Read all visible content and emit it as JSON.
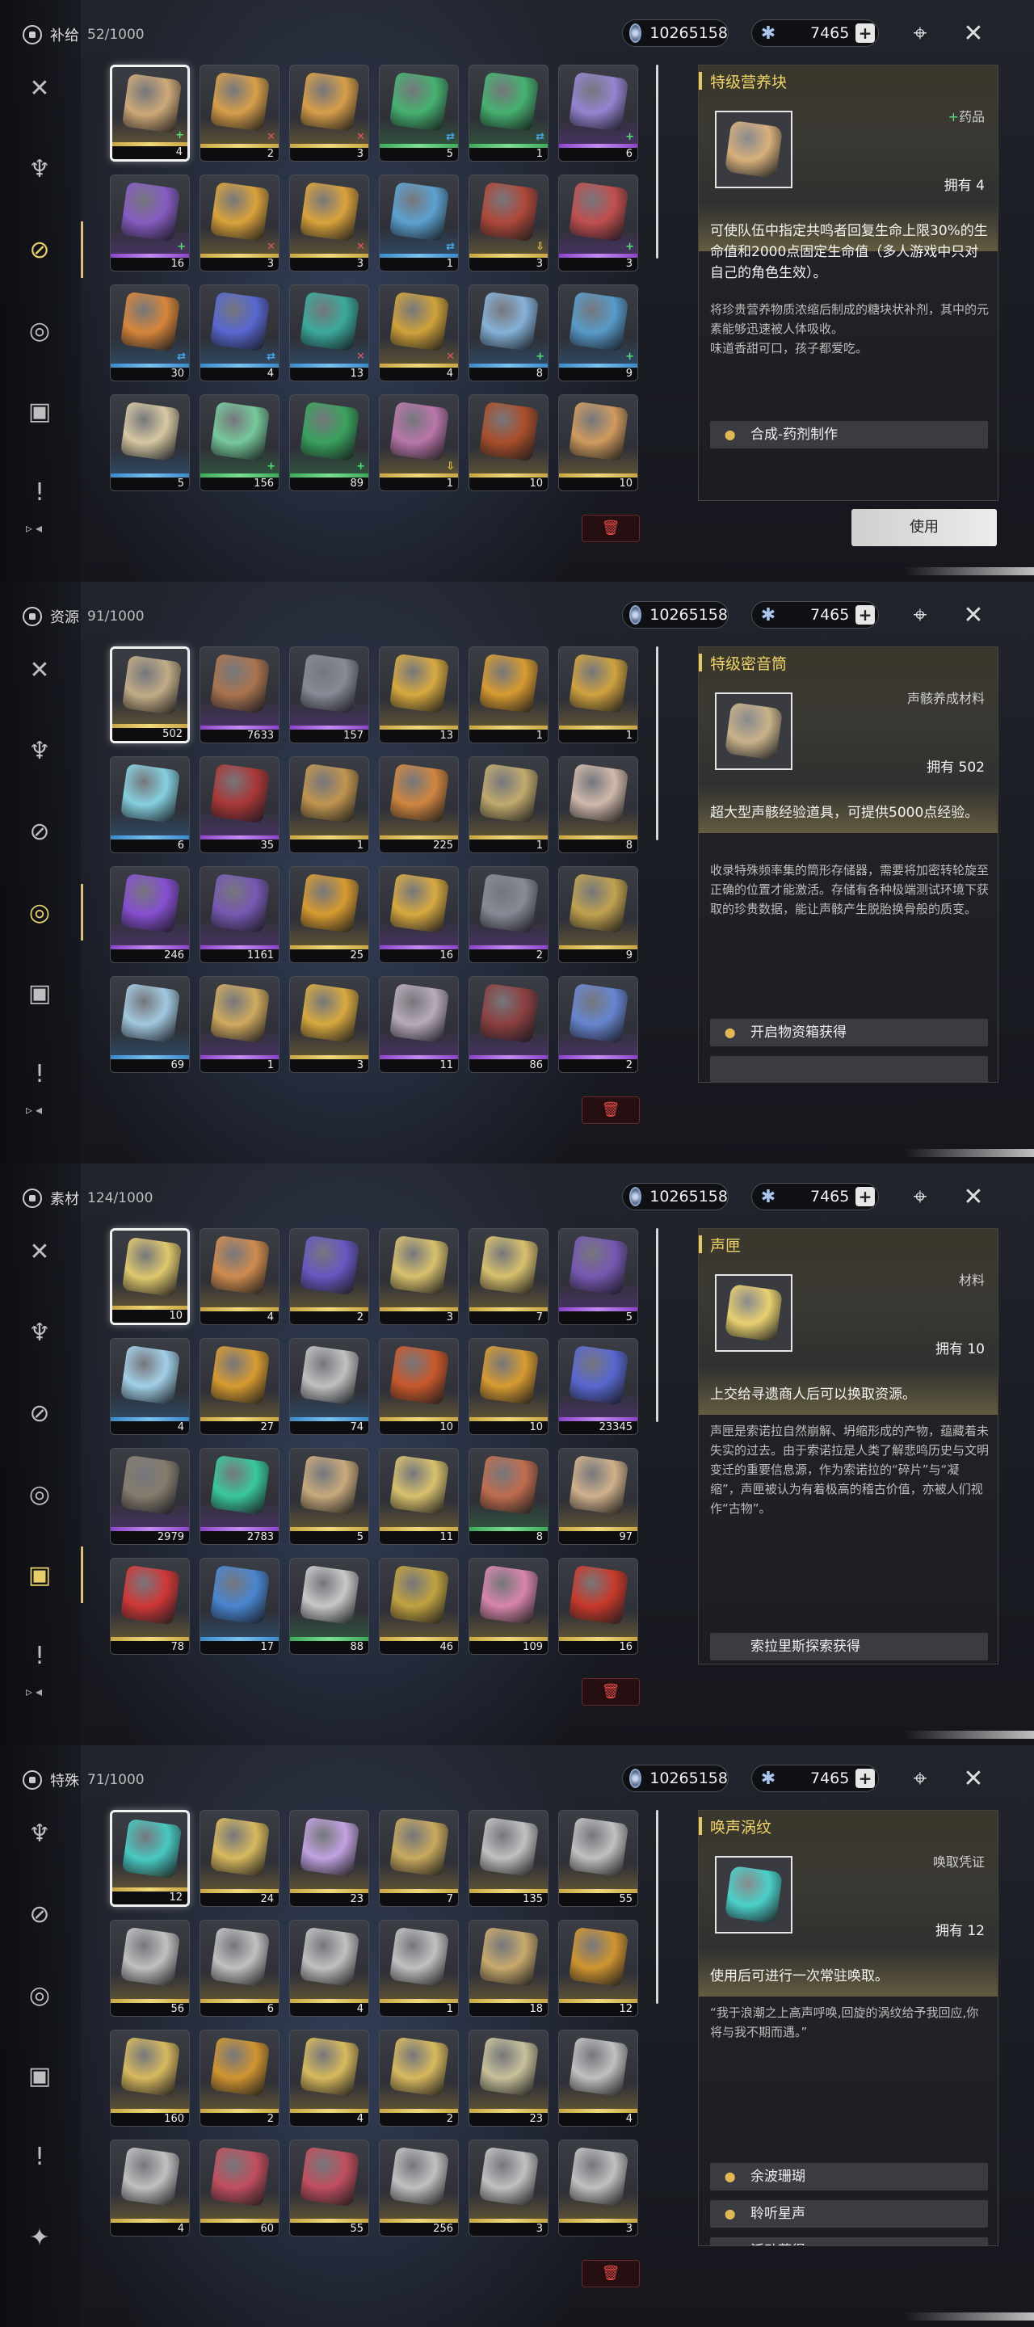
{
  "currency": {
    "primary": "10265158",
    "secondary": "7465",
    "plus": "+"
  },
  "panels": [
    {
      "title": "补给",
      "count": "52/1000",
      "active_index": 2,
      "items": [
        {
          "count": "4",
          "rarity": "g",
          "badge": "plus",
          "art": "#d7b07c"
        },
        {
          "count": "2",
          "rarity": "g",
          "badge": "x",
          "art": "#e0a44a"
        },
        {
          "count": "3",
          "rarity": "g",
          "badge": "x",
          "art": "#e0a44a"
        },
        {
          "count": "5",
          "rarity": "n",
          "badge": "swap",
          "art": "#47b873"
        },
        {
          "count": "1",
          "rarity": "n",
          "badge": "swap",
          "art": "#47b873"
        },
        {
          "count": "6",
          "rarity": "p",
          "badge": "plus",
          "art": "#9a88d8"
        },
        {
          "count": "16",
          "rarity": "p",
          "badge": "plus",
          "art": "#8a5ec8"
        },
        {
          "count": "3",
          "rarity": "g",
          "badge": "x",
          "art": "#e3a83c"
        },
        {
          "count": "3",
          "rarity": "g",
          "badge": "x",
          "art": "#e3a83c"
        },
        {
          "count": "1",
          "rarity": "b",
          "badge": "swap",
          "art": "#5fa7d8"
        },
        {
          "count": "3",
          "rarity": "g",
          "badge": "down",
          "art": "#b5493a"
        },
        {
          "count": "3",
          "rarity": "p",
          "badge": "plus",
          "art": "#c85050"
        },
        {
          "count": "30",
          "rarity": "b",
          "badge": "swap",
          "art": "#e08a3a"
        },
        {
          "count": "4",
          "rarity": "b",
          "badge": "swap",
          "art": "#5a6ad8"
        },
        {
          "count": "13",
          "rarity": "b",
          "badge": "x",
          "art": "#3ab0a0"
        },
        {
          "count": "4",
          "rarity": "g",
          "badge": "x",
          "art": "#d8a83a"
        },
        {
          "count": "8",
          "rarity": "b",
          "badge": "plus",
          "art": "#8ab8e0"
        },
        {
          "count": "9",
          "rarity": "b",
          "badge": "plus",
          "art": "#5aa0d0"
        },
        {
          "count": "5",
          "rarity": "b",
          "badge": "",
          "art": "#e0d0a8"
        },
        {
          "count": "156",
          "rarity": "n",
          "badge": "plus",
          "art": "#7ad0a0"
        },
        {
          "count": "89",
          "rarity": "n",
          "badge": "plus",
          "art": "#3aa860"
        },
        {
          "count": "1",
          "rarity": "g",
          "badge": "down",
          "art": "#c07ab0"
        },
        {
          "count": "10",
          "rarity": "g",
          "badge": "",
          "art": "#b0502a"
        },
        {
          "count": "10",
          "rarity": "g",
          "badge": "",
          "art": "#d8a060"
        }
      ],
      "detail": {
        "name": "特级营养块",
        "type": "药品",
        "type_prefix": "+",
        "owned": "拥有 4",
        "art": "#d7b07c",
        "main": "可使队伍中指定共鸣者回复生命上限30%的生命值和2000点固定生命值（多人游戏中只对自己的角色生效）。",
        "desc": "将珍贵营养物质浓缩后制成的糖块状补剂，其中的元素能够迅速被人体吸收。\n味道香甜可口，孩子都爱吃。",
        "sources": [
          "合成-药剂制作"
        ],
        "use_button": "使用"
      }
    },
    {
      "title": "资源",
      "count": "91/1000",
      "active_index": 3,
      "items": [
        {
          "count": "502",
          "rarity": "g",
          "badge": "",
          "art": "#c9b28a"
        },
        {
          "count": "7633",
          "rarity": "p",
          "badge": "",
          "art": "#b07850"
        },
        {
          "count": "157",
          "rarity": "p",
          "badge": "",
          "art": "#8a8f9a"
        },
        {
          "count": "13",
          "rarity": "g",
          "badge": "",
          "art": "#e0b040"
        },
        {
          "count": "1",
          "rarity": "g",
          "badge": "",
          "art": "#e0a030"
        },
        {
          "count": "1",
          "rarity": "g",
          "badge": "",
          "art": "#d8a840"
        },
        {
          "count": "6",
          "rarity": "b",
          "badge": "",
          "art": "#8ad8e8"
        },
        {
          "count": "35",
          "rarity": "p",
          "badge": "",
          "art": "#b03838"
        },
        {
          "count": "1",
          "rarity": "g",
          "badge": "",
          "art": "#c89a50"
        },
        {
          "count": "225",
          "rarity": "g",
          "badge": "",
          "art": "#d88a40"
        },
        {
          "count": "1",
          "rarity": "g",
          "badge": "",
          "art": "#c8b070"
        },
        {
          "count": "8",
          "rarity": "g",
          "badge": "",
          "art": "#d8c0b0"
        },
        {
          "count": "246",
          "rarity": "p",
          "badge": "",
          "art": "#8a50d8"
        },
        {
          "count": "1161",
          "rarity": "p",
          "badge": "",
          "art": "#7a5ab8"
        },
        {
          "count": "25",
          "rarity": "g",
          "badge": "",
          "art": "#e0a030"
        },
        {
          "count": "16",
          "rarity": "p",
          "badge": "",
          "art": "#e0b040"
        },
        {
          "count": "2",
          "rarity": "p",
          "badge": "",
          "art": "#8a8f9a"
        },
        {
          "count": "9",
          "rarity": "g",
          "badge": "",
          "art": "#c8a850"
        },
        {
          "count": "69",
          "rarity": "b",
          "badge": "",
          "art": "#a8d0e8"
        },
        {
          "count": "1",
          "rarity": "p",
          "badge": "",
          "art": "#d8b060"
        },
        {
          "count": "3",
          "rarity": "g",
          "badge": "",
          "art": "#e0b040"
        },
        {
          "count": "11",
          "rarity": "p",
          "badge": "",
          "art": "#c0b0c0"
        },
        {
          "count": "86",
          "rarity": "p",
          "badge": "",
          "art": "#904040"
        },
        {
          "count": "2",
          "rarity": "p",
          "badge": "",
          "art": "#6a8ad8"
        }
      ],
      "detail": {
        "name": "特级密音筒",
        "type": "声骸养成材料",
        "type_prefix": "",
        "owned": "拥有 502",
        "art": "#c9b28a",
        "main": "超大型声骸经验道具，可提供5000点经验。",
        "desc": "收录特殊频率集的筒形存储器，需要将加密转轮旋至正确的位置才能激活。存储有各种极端测试环境下获取的珍贵数据，能让声骸产生脱胎换骨般的质变。",
        "sources": [
          "开启物资箱获得",
          ""
        ],
        "use_button": ""
      }
    },
    {
      "title": "素材",
      "count": "124/1000",
      "active_index": 4,
      "items": [
        {
          "count": "10",
          "rarity": "g",
          "badge": "",
          "art": "#e8d070"
        },
        {
          "count": "4",
          "rarity": "g",
          "badge": "",
          "art": "#d89050"
        },
        {
          "count": "2",
          "rarity": "g",
          "badge": "",
          "art": "#6a5ac8"
        },
        {
          "count": "3",
          "rarity": "g",
          "badge": "",
          "art": "#e0c870"
        },
        {
          "count": "7",
          "rarity": "g",
          "badge": "",
          "art": "#e0c870"
        },
        {
          "count": "5",
          "rarity": "p",
          "badge": "",
          "art": "#7a5ab8"
        },
        {
          "count": "4",
          "rarity": "b",
          "badge": "",
          "art": "#a8d8f0"
        },
        {
          "count": "27",
          "rarity": "g",
          "badge": "",
          "art": "#e0a030"
        },
        {
          "count": "74",
          "rarity": "b",
          "badge": "",
          "art": "#c8c8c8"
        },
        {
          "count": "10",
          "rarity": "g",
          "badge": "",
          "art": "#d05a2a"
        },
        {
          "count": "10",
          "rarity": "g",
          "badge": "",
          "art": "#e0a030"
        },
        {
          "count": "23345",
          "rarity": "p",
          "badge": "",
          "art": "#5a6ad8"
        },
        {
          "count": "2979",
          "rarity": "p",
          "badge": "",
          "art": "#8a8070"
        },
        {
          "count": "2783",
          "rarity": "p",
          "badge": "",
          "art": "#3ad0a0"
        },
        {
          "count": "5",
          "rarity": "g",
          "badge": "",
          "art": "#d0b080"
        },
        {
          "count": "11",
          "rarity": "g",
          "badge": "",
          "art": "#e0c870"
        },
        {
          "count": "8",
          "rarity": "n",
          "badge": "",
          "art": "#c87050"
        },
        {
          "count": "97",
          "rarity": "g",
          "badge": "",
          "art": "#d8b890"
        },
        {
          "count": "78",
          "rarity": "g",
          "badge": "",
          "art": "#d83838"
        },
        {
          "count": "17",
          "rarity": "b",
          "badge": "",
          "art": "#4a8ad8"
        },
        {
          "count": "88",
          "rarity": "n",
          "badge": "",
          "art": "#d0d0d0"
        },
        {
          "count": "46",
          "rarity": "g",
          "badge": "",
          "art": "#c8a840"
        },
        {
          "count": "109",
          "rarity": "g",
          "badge": "",
          "art": "#e08ab0"
        },
        {
          "count": "16",
          "rarity": "g",
          "badge": "",
          "art": "#d03a2a"
        }
      ],
      "detail": {
        "name": "声匣",
        "type": "材料",
        "type_prefix": "",
        "owned": "拥有 10",
        "art": "#e8d070",
        "main": "上交给寻遗商人后可以换取资源。",
        "desc": "声匣是索诺拉自然崩解、坍缩形成的产物，蕴藏着未失实的过去。由于索诺拉是人类了解悲鸣历史与文明变迁的重要信息源，作为索诺拉的“碎片”与“凝缩”，声匣被认为有着极高的稽古价值，亦被人们视作“古物”。",
        "sources": [
          "索拉里斯探索获得"
        ],
        "use_button": ""
      }
    },
    {
      "title": "特殊",
      "count": "71/1000",
      "active_index": 6,
      "items": [
        {
          "count": "12",
          "rarity": "g",
          "badge": "",
          "art": "#4ad0c8"
        },
        {
          "count": "24",
          "rarity": "g",
          "badge": "",
          "art": "#e0c060"
        },
        {
          "count": "23",
          "rarity": "g",
          "badge": "",
          "art": "#c8a8e8"
        },
        {
          "count": "7",
          "rarity": "g",
          "badge": "",
          "art": "#d0b060"
        },
        {
          "count": "135",
          "rarity": "g",
          "badge": "",
          "art": "#c8c8c8"
        },
        {
          "count": "55",
          "rarity": "g",
          "badge": "",
          "art": "#c8c8c8"
        },
        {
          "count": "56",
          "rarity": "g",
          "badge": "",
          "art": "#c8c8c8"
        },
        {
          "count": "6",
          "rarity": "g",
          "badge": "",
          "art": "#c8c8c8"
        },
        {
          "count": "4",
          "rarity": "g",
          "badge": "",
          "art": "#c8c8c8"
        },
        {
          "count": "1",
          "rarity": "g",
          "badge": "",
          "art": "#c8c8c8"
        },
        {
          "count": "18",
          "rarity": "g",
          "badge": "",
          "art": "#d0b070"
        },
        {
          "count": "12",
          "rarity": "g",
          "badge": "",
          "art": "#d89a30"
        },
        {
          "count": "160",
          "rarity": "g",
          "badge": "",
          "art": "#e0c060"
        },
        {
          "count": "2",
          "rarity": "g",
          "badge": "",
          "art": "#d89a30"
        },
        {
          "count": "4",
          "rarity": "g",
          "badge": "",
          "art": "#e0c060"
        },
        {
          "count": "2",
          "rarity": "g",
          "badge": "",
          "art": "#e0c060"
        },
        {
          "count": "23",
          "rarity": "g",
          "badge": "",
          "art": "#d0c8a0"
        },
        {
          "count": "4",
          "rarity": "g",
          "badge": "",
          "art": "#c8c8c8"
        },
        {
          "count": "4",
          "rarity": "g",
          "badge": "",
          "art": "#c8c8c8"
        },
        {
          "count": "60",
          "rarity": "g",
          "badge": "",
          "art": "#c85060"
        },
        {
          "count": "55",
          "rarity": "g",
          "badge": "",
          "art": "#c85060"
        },
        {
          "count": "256",
          "rarity": "g",
          "badge": "",
          "art": "#c8c8c8"
        },
        {
          "count": "3",
          "rarity": "g",
          "badge": "",
          "art": "#c8c8c8"
        },
        {
          "count": "3",
          "rarity": "g",
          "badge": "",
          "art": "#c8c8c8"
        }
      ],
      "detail": {
        "name": "唤声涡纹",
        "type": "唤取凭证",
        "type_prefix": "",
        "owned": "拥有 12",
        "art": "#4ad0c8",
        "main": "使用后可进行一次常驻唤取。",
        "desc": "“我于浪潮之上高声呼唤,回旋的涡纹给予我回应,你将与我不期而遇。”",
        "sources": [
          "余波珊瑚",
          "聆听星声",
          "活动获得"
        ],
        "use_button": ""
      }
    }
  ],
  "sidebar_icons": [
    "sword-icon",
    "demon-mask-icon",
    "link-icon",
    "resource-icon",
    "material-icon",
    "notice-icon",
    "special-icon"
  ],
  "sidebar_glyphs": [
    "✕",
    "♆",
    "⊘",
    "◎",
    "▣",
    "!",
    "✦"
  ],
  "top_icons": [
    "target-icon",
    "cross-icon"
  ],
  "top_glyphs": [
    "⌖",
    "✕"
  ],
  "expand_glyph": "▹◂",
  "delete_glyph": "🗑"
}
